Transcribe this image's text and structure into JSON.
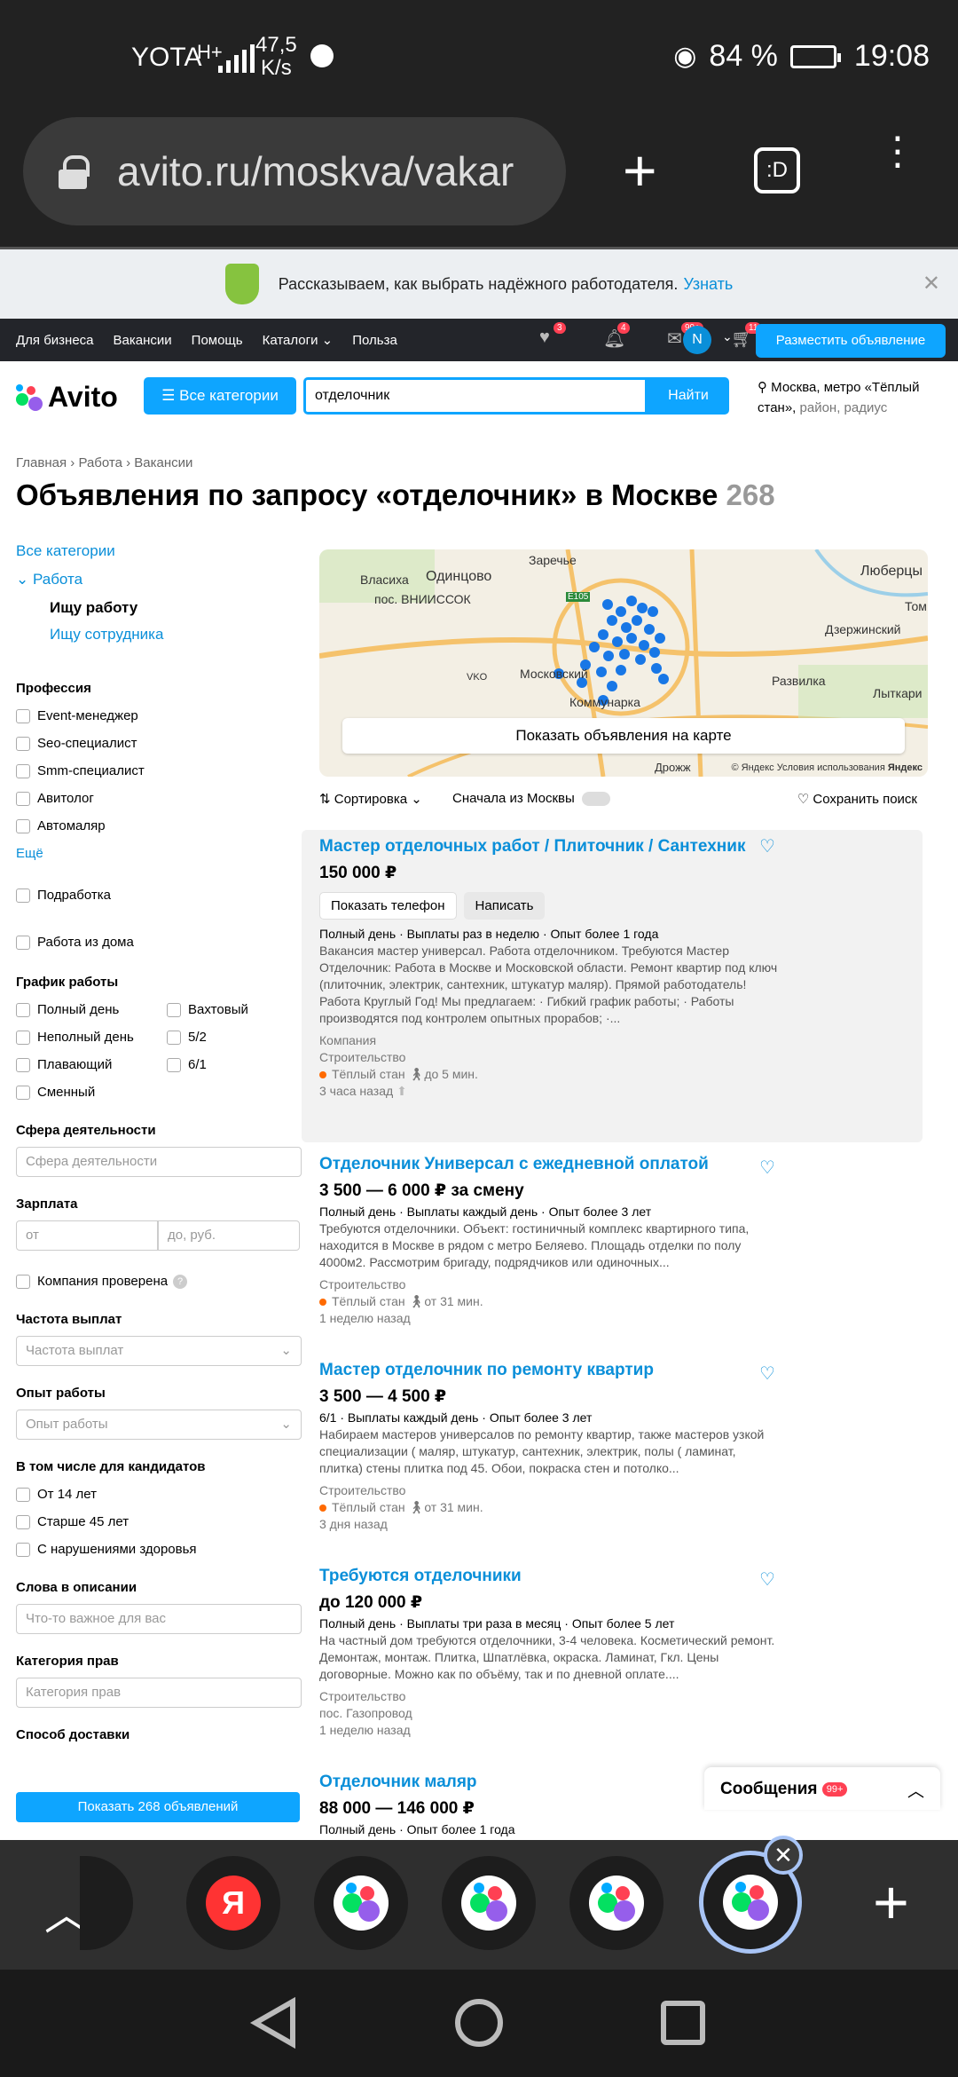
{
  "status_bar": {
    "carrier": "YOTA",
    "network": "H+",
    "speed": "47,5\nK/s",
    "battery": "84 %",
    "time": "19:08"
  },
  "browser": {
    "url": "avito.ru/moskva/vakar"
  },
  "notice": {
    "text": "Рассказываем, как выбрать надёжного работодателя.",
    "link": "Узнать"
  },
  "topnav": {
    "items": [
      "Для бизнеса",
      "Вакансии",
      "Помощь",
      "Каталоги",
      "Польза"
    ],
    "badges": [
      "3",
      "4",
      "99+",
      "11"
    ],
    "avatar": "N",
    "post_button": "Разместить объявление"
  },
  "header": {
    "logo": "Avito",
    "categories_button": "Все категории",
    "search_value": "отделочник",
    "find_button": "Найти",
    "location_main": "Москва, метро «Тёплый стан»,",
    "location_extra": "район, радиус"
  },
  "breadcrumbs": [
    "Главная",
    "Работа",
    "Вакансии"
  ],
  "page_title": "Объявления по запросу «отделочник» в Москве",
  "result_count": "268",
  "sidebar": {
    "all_categories": "Все категории",
    "category": "Работа",
    "sub_active": "Ищу работу",
    "sub_other": "Ищу сотрудника",
    "profession_title": "Профессия",
    "professions": [
      "Event-менеджер",
      "Seo-специалист",
      "Smm-специалист",
      "Авитолог",
      "Автомаляр"
    ],
    "more": "Ещё",
    "parttime": "Подработка",
    "remote": "Работа из дома",
    "schedule_title": "График работы",
    "schedule_left": [
      "Полный день",
      "Неполный день",
      "Плавающий",
      "Сменный"
    ],
    "schedule_right": [
      "Вахтовый",
      "5/2",
      "6/1"
    ],
    "sphere_title": "Сфера деятельности",
    "sphere_placeholder": "Сфера деятельности",
    "salary_title": "Зарплата",
    "salary_from": "от",
    "salary_to": "до, руб.",
    "company_verified": "Компания проверена",
    "payout_title": "Частота выплат",
    "payout_placeholder": "Частота выплат",
    "exp_title": "Опыт работы",
    "exp_placeholder": "Опыт работы",
    "candidates_title": "В том числе для кандидатов",
    "candidates": [
      "От 14 лет",
      "Старше 45 лет",
      "С нарушениями здоровья"
    ],
    "words_title": "Слова в описании",
    "words_placeholder": "Что-то важное для вас",
    "license_title": "Категория прав",
    "license_placeholder": "Категория прав",
    "delivery_title": "Способ доставки",
    "show_button": "Показать 268 объявлений"
  },
  "map": {
    "labels": [
      "Одинцово",
      "Заречье",
      "Люберцы",
      "Власиха",
      "пос. ВНИИССОК",
      "Дзержинский",
      "Том",
      "Московский",
      "Развилка",
      "Лыткари",
      "Коммунарка",
      "VKO",
      "E105",
      "Дрожж"
    ],
    "show_button": "Показать объявления на карте",
    "copyright": "© Яндекс Условия использования",
    "brand": "Яндекс"
  },
  "sort": {
    "label": "Сортировка",
    "moscow_first": "Сначала из Москвы",
    "save_search": "Сохранить поиск"
  },
  "listings": [
    {
      "title": "Мастер отделочных работ / Плиточник / Сантехник",
      "price": "150 000 ₽",
      "phone_btn": "Показать телефон",
      "write_btn": "Написать",
      "meta": "Полный день · Выплаты раз в неделю · Опыт более 1 года",
      "desc": "Вакансия мастер универсал. Работа отделочником. Требуются Мастер Отделочник: Работа в Москве и Московской области. Ремонт квартир под ключ (плиточник, электрик, сантехник, штукатур маляр). Прямой работодатель! Работа Круглый Год! Мы предлагаем: · Гибкий график работы; · Работы производятся под контролем опытных прорабов; ·...",
      "company": "Компания",
      "category": "Строительство",
      "metro": "Тёплый стан",
      "walk": "до 5 мин.",
      "time": "3 часа назад"
    },
    {
      "title": "Отделочник Универсал с ежедневной оплатой",
      "price": "3 500 — 6 000 ₽ за смену",
      "meta": "Полный день · Выплаты каждый день · Опыт более 3 лет",
      "desc": "Требуются отделочники. Объект: гостиничный комплекс квартирного типа, находится в Москве в рядом с метро Беляево. Площадь отделки по полу 4000м2. Рассмотрим бригаду, подрядчиков или одиночных...",
      "category": "Строительство",
      "metro": "Тёплый стан",
      "walk": "от 31 мин.",
      "time": "1 неделю назад"
    },
    {
      "title": "Мастер отделочник по ремонту квартир",
      "price": "3 500 — 4 500 ₽",
      "meta": "6/1 · Выплаты каждый день · Опыт более 3 лет",
      "desc": "Набираем мастеров универсалов по ремонту квартир, также мастеров узкой специализации ( маляр, штукатур, сантехник, электрик, полы ( ламинат, плитка) стены плитка под 45. Обои, покраска стен и потолко...",
      "category": "Строительство",
      "metro": "Тёплый стан",
      "walk": "от 31 мин.",
      "time": "3 дня назад"
    },
    {
      "title": "Требуются отделочники",
      "price": "до 120 000 ₽",
      "meta": "Полный день · Выплаты три раза в месяц · Опыт более 5 лет",
      "desc": "На частный дом требуются отделочники, 3-4 человека. Косметический ремонт. Демонтаж, монтаж. Плитка, Шпатлёвка, окраска. Ламинат, Гкл. Цены договорные. Можно как по объёму, так и по дневной оплате....",
      "category": "Строительство",
      "location": "пос. Газопровод",
      "time": "1 неделю назад"
    },
    {
      "title": "Отделочник маляр",
      "price": "88 000 — 146 000 ₽",
      "meta": "Полный день · Опыт более 1 года"
    }
  ],
  "messages": {
    "label": "Сообщения",
    "badge": "99+"
  }
}
